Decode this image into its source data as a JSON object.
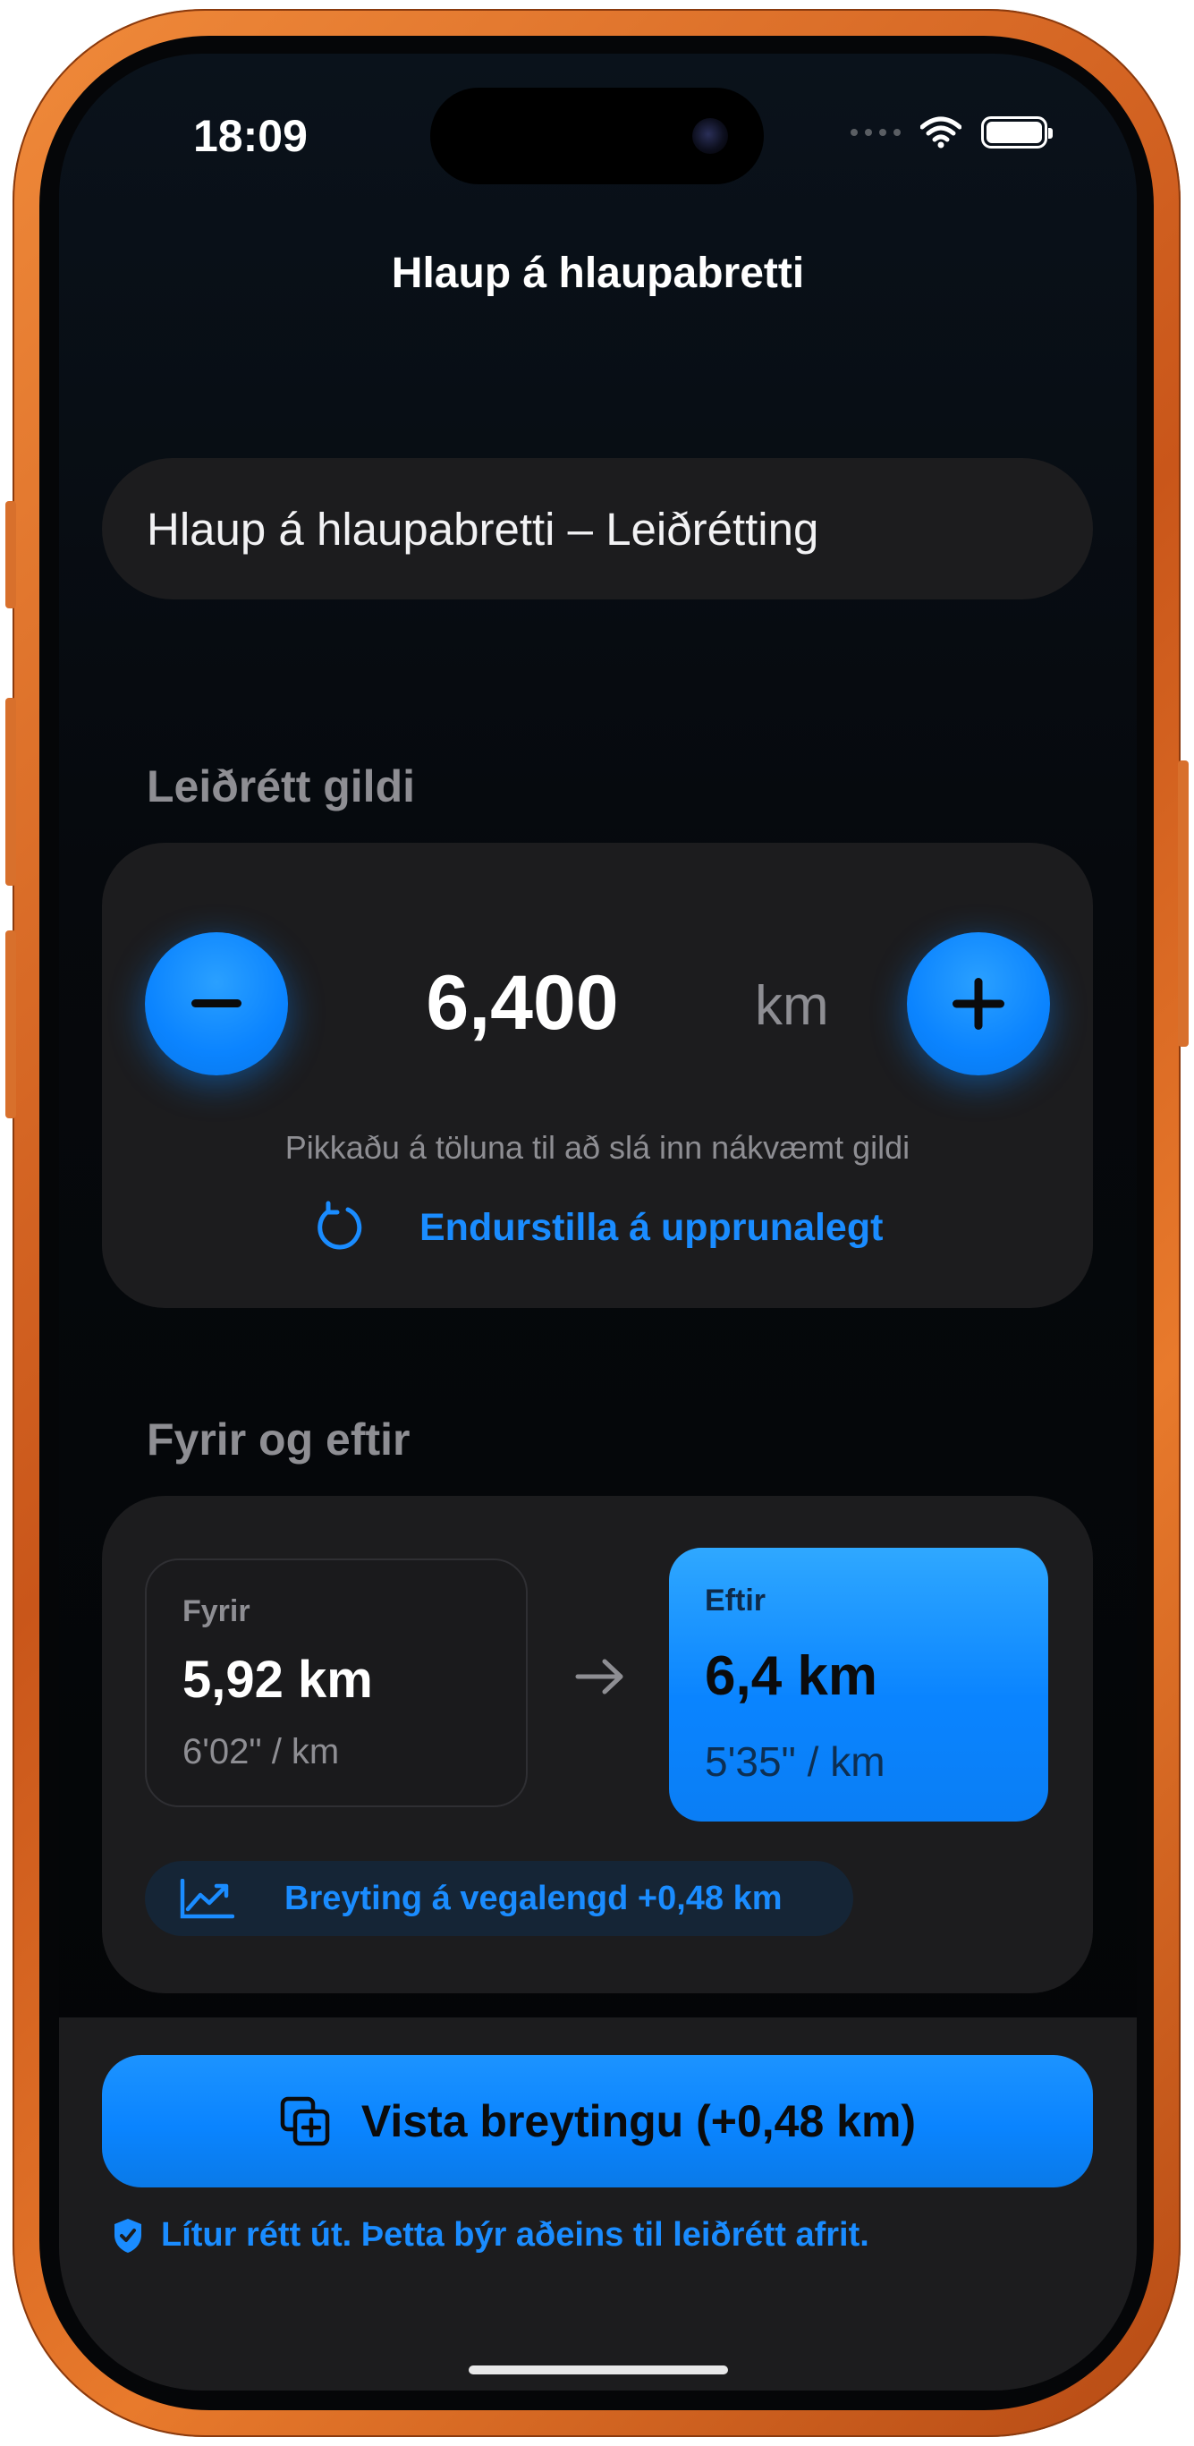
{
  "status_bar": {
    "time": "18:09"
  },
  "nav": {
    "title": "Hlaup á hlaupabretti"
  },
  "name_field": {
    "value": "Hlaup á hlaupabretti – Leiðrétting"
  },
  "adjust_section": {
    "label": "Leiðrétt gildi",
    "value": "6,400",
    "unit": "km",
    "hint": "Pikkaðu á töluna til að slá inn nákvæmt gildi",
    "reset_label": "Endurstilla á upprunalegt"
  },
  "compare_section": {
    "label": "Fyrir og eftir",
    "before": {
      "label": "Fyrir",
      "value": "5,92 km",
      "pace": "6'02\" / km"
    },
    "after": {
      "label": "Eftir",
      "value": "6,4 km",
      "pace": "5'35\" / km"
    },
    "change_label": "Breyting á vegalengd +0,48 km"
  },
  "footer": {
    "save_label": "Vista breytingu (+0,48 km)",
    "note": "Lítur rétt út. Þetta býr aðeins til leiðrétt afrit."
  },
  "colors": {
    "accent": "#0a84ff",
    "card": "#1c1c1e",
    "secondary_text": "#8e8e93",
    "frame": "#e0722a"
  },
  "icons": [
    "minus-icon",
    "plus-icon",
    "reset-icon",
    "arrow-right-icon",
    "trend-up-icon",
    "duplicate-plus-icon",
    "shield-check-icon",
    "wifi-icon",
    "battery-icon"
  ]
}
